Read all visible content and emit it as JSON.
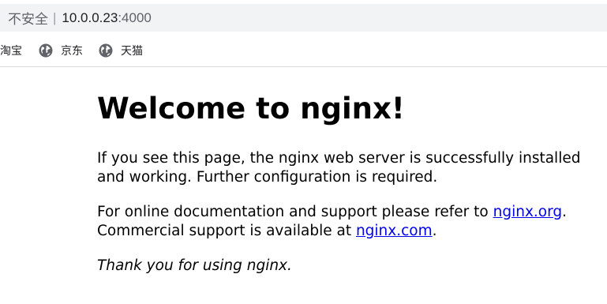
{
  "browser": {
    "security_label": "不安全",
    "separator": "|",
    "url_host": "10.0.0.23",
    "url_port": ":4000"
  },
  "bookmarks": [
    {
      "label": "淘宝",
      "icon": "none"
    },
    {
      "label": "京东",
      "icon": "globe-icon"
    },
    {
      "label": "天猫",
      "icon": "globe-icon"
    }
  ],
  "page": {
    "heading": "Welcome to nginx!",
    "p1": "If you see this page, the nginx web server is successfully installed and working. Further configuration is required.",
    "p2_before": "For online documentation and support please refer to ",
    "link_org": "nginx.org",
    "p2_mid": ".",
    "p2_commercial": "Commercial support is available at ",
    "link_com": "nginx.com",
    "p2_end": ".",
    "p3": "Thank you for using nginx."
  },
  "colors": {
    "address_bar_bg": "#f1f3f4",
    "link": "#0000ee",
    "text": "#000000"
  }
}
